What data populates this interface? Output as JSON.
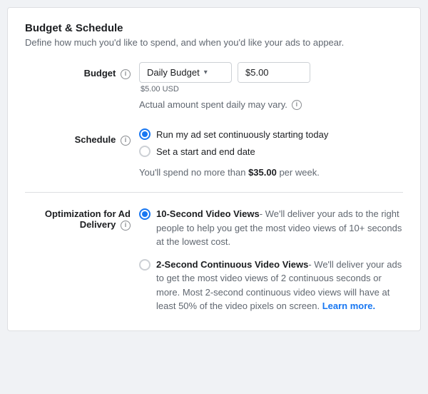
{
  "page": {
    "title": "Budget & Schedule",
    "subtitle": "Define how much you'd like to spend, and when you'd like your ads to appear."
  },
  "budget": {
    "label": "Budget",
    "dropdown_value": "Daily Budget",
    "amount": "$5.00",
    "amount_usd": "$5.00 USD",
    "note": "Actual amount spent daily may vary."
  },
  "schedule": {
    "label": "Schedule",
    "options": [
      {
        "label": "Run my ad set continuously starting today",
        "selected": true
      },
      {
        "label": "Set a start and end date",
        "selected": false
      }
    ],
    "weekly_note_prefix": "You'll spend no more than ",
    "weekly_amount": "$35.00",
    "weekly_note_suffix": " per week."
  },
  "optimization": {
    "label": "Optimization for Ad Delivery",
    "options": [
      {
        "title": "10-Second Video Views",
        "description": "- We'll deliver your ads to the right people to help you get the most video views of 10+ seconds at the lowest cost.",
        "selected": true,
        "learn_more": null
      },
      {
        "title": "2-Second Continuous Video Views",
        "description": "- We'll deliver your ads to get the most video views of 2 continuous seconds or more. Most 2-second continuous video views will have at least 50% of the video pixels on screen.",
        "selected": false,
        "learn_more": "Learn more."
      }
    ]
  },
  "icons": {
    "info": "i",
    "arrow_down": "▾"
  }
}
